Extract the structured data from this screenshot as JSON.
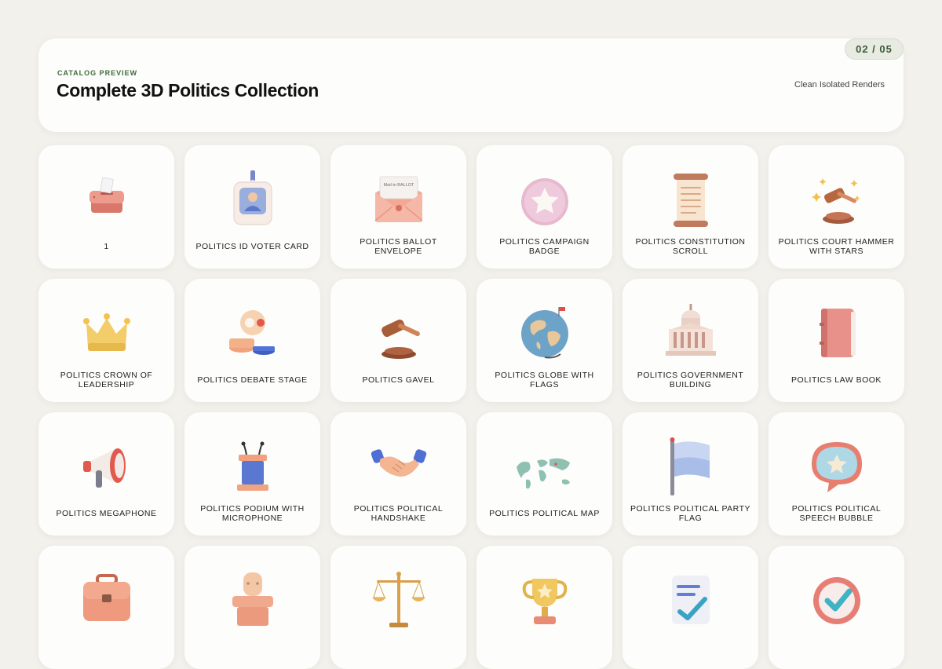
{
  "header": {
    "eyebrow": "CATALOG PREVIEW",
    "title": "Complete 3D Politics Collection",
    "subtitle": "Clean Isolated Renders",
    "page_indicator": "02 / 05"
  },
  "cards": [
    {
      "label": "1",
      "icon": "ballot-box-icon"
    },
    {
      "label": "POLITICS ID VOTER CARD",
      "icon": "voter-id-card-icon"
    },
    {
      "label": "POLITICS BALLOT ENVELOPE",
      "icon": "ballot-envelope-icon",
      "envelope_text": "Mail-in BALLOT"
    },
    {
      "label": "POLITICS CAMPAIGN BADGE",
      "icon": "campaign-badge-icon"
    },
    {
      "label": "POLITICS CONSTITUTION SCROLL",
      "icon": "constitution-scroll-icon"
    },
    {
      "label": "POLITICS COURT HAMMER WITH STARS",
      "icon": "court-hammer-stars-icon"
    },
    {
      "label": "POLITICS CROWN OF LEADERSHIP",
      "icon": "crown-icon"
    },
    {
      "label": "POLITICS DEBATE STAGE",
      "icon": "debate-stage-icon"
    },
    {
      "label": "POLITICS GAVEL",
      "icon": "gavel-icon"
    },
    {
      "label": "POLITICS GLOBE WITH FLAGS",
      "icon": "globe-flags-icon"
    },
    {
      "label": "POLITICS GOVERNMENT BUILDING",
      "icon": "government-building-icon"
    },
    {
      "label": "POLITICS LAW BOOK",
      "icon": "law-book-icon"
    },
    {
      "label": "POLITICS MEGAPHONE",
      "icon": "megaphone-icon"
    },
    {
      "label": "POLITICS PODIUM WITH MICROPHONE",
      "icon": "podium-microphone-icon"
    },
    {
      "label": "POLITICS POLITICAL HANDSHAKE",
      "icon": "handshake-icon"
    },
    {
      "label": "POLITICS POLITICAL MAP",
      "icon": "world-map-icon"
    },
    {
      "label": "POLITICS POLITICAL PARTY FLAG",
      "icon": "party-flag-icon"
    },
    {
      "label": "POLITICS POLITICAL SPEECH BUBBLE",
      "icon": "speech-bubble-icon"
    },
    {
      "label": "",
      "icon": "briefcase-icon"
    },
    {
      "label": "",
      "icon": "chair-desk-icon"
    },
    {
      "label": "",
      "icon": "justice-scales-icon"
    },
    {
      "label": "",
      "icon": "trophy-icon"
    },
    {
      "label": "",
      "icon": "checklist-icon"
    },
    {
      "label": "",
      "icon": "checkmark-badge-icon"
    }
  ],
  "colors": {
    "background": "#f3f1ec",
    "card": "#fdfdfb",
    "accent_green": "#3d6a3b"
  }
}
